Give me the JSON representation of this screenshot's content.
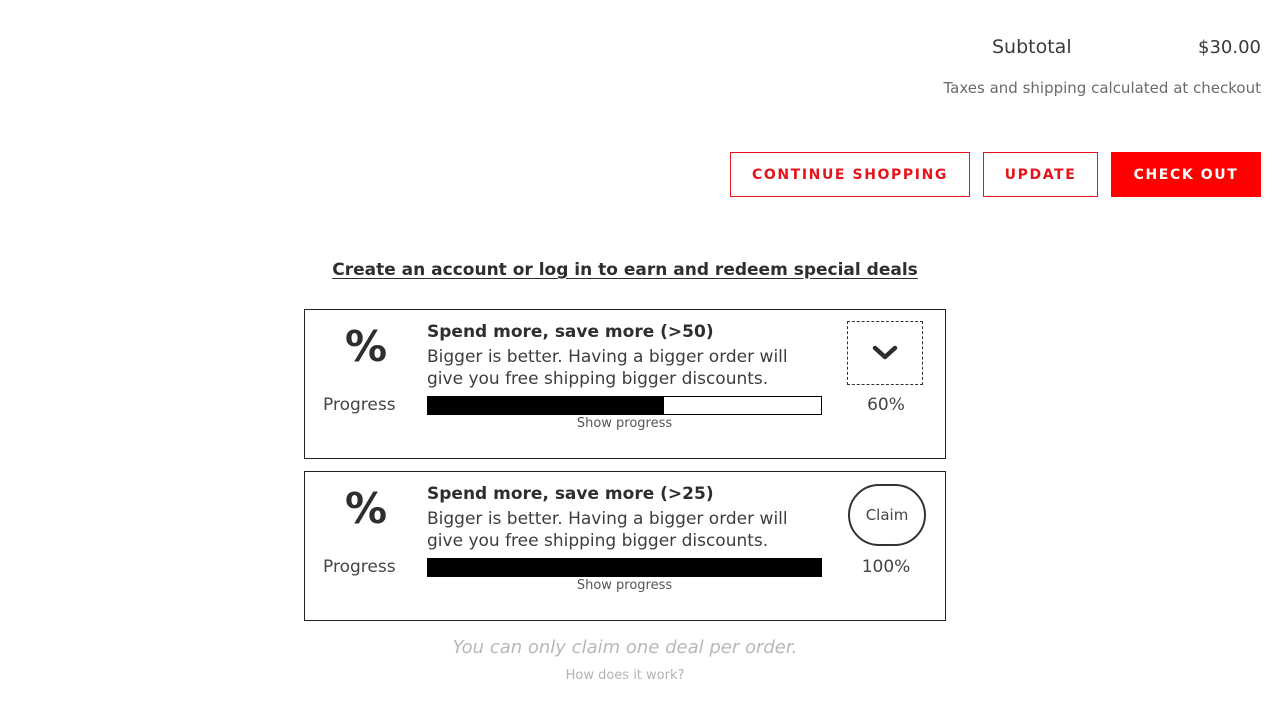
{
  "cart": {
    "subtotal_label": "Subtotal",
    "subtotal_value": "$30.00",
    "tax_note": "Taxes and shipping calculated at checkout"
  },
  "buttons": {
    "continue_shopping": "CONTINUE SHOPPING",
    "update": "UPDATE",
    "check_out": "CHECK OUT"
  },
  "deals": {
    "account_link": "Create an account or log in to earn and redeem special deals",
    "items": [
      {
        "icon": "%",
        "progress_label": "Progress",
        "title": "Spend more, save more (>50)",
        "description": "Bigger is better. Having a bigger order will give you free shipping bigger discounts.",
        "progress_percent": 60,
        "percent_text": "60%",
        "show_progress": "Show progress",
        "action_icon": "chevron-down-icon"
      },
      {
        "icon": "%",
        "progress_label": "Progress",
        "title": "Spend more, save more (>25)",
        "description": "Bigger is better. Having a bigger order will give you free shipping bigger discounts.",
        "progress_percent": 100,
        "percent_text": "100%",
        "show_progress": "Show progress",
        "claim_label": "Claim"
      }
    ],
    "note": "You can only claim one deal per order.",
    "how_link": "How does it work?"
  },
  "colors": {
    "accent": "#ff0000",
    "accent_border": "#e5131b",
    "text": "#3a3a3a",
    "muted": "#b8b8b8"
  }
}
